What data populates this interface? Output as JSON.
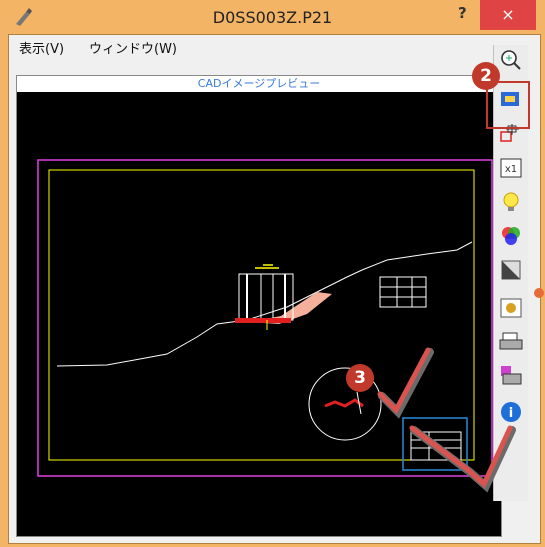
{
  "window": {
    "title": "D0SS003Z.P21",
    "help_label": "?",
    "close_label": "×"
  },
  "menubar": {
    "items": [
      {
        "label": "表示(V)"
      },
      {
        "label": "ウィンドウ(W)"
      }
    ]
  },
  "preview": {
    "caption": "CADイメージプレビュー"
  },
  "toolbar": {
    "buttons": [
      {
        "icon": "zoom-icon"
      },
      {
        "icon": "select-window-icon"
      },
      {
        "icon": "pan-icon"
      },
      {
        "icon": "fit-scale-icon"
      },
      {
        "icon": "lightbulb-icon"
      },
      {
        "icon": "color-icon"
      },
      {
        "icon": "contrast-icon"
      },
      {
        "icon": "settings-icon"
      },
      {
        "icon": "print-icon"
      },
      {
        "icon": "print-preview-icon"
      },
      {
        "icon": "info-icon"
      }
    ]
  },
  "annotations": {
    "step2": "2",
    "step3": "3"
  },
  "colors": {
    "window_frame": "#f3b565",
    "close_button": "#e04343",
    "badge": "#c0392b",
    "cad_border_outer": "#e040e0",
    "cad_border_inner": "#ffff00",
    "highlight_box": "#2a8ad8"
  }
}
